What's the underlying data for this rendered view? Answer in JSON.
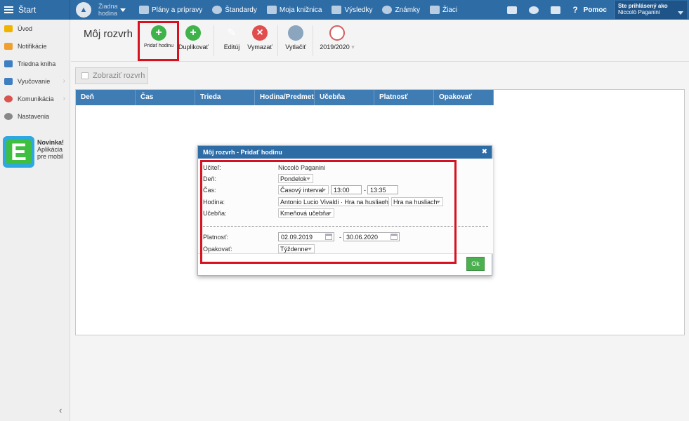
{
  "topbar": {
    "start_label": "Štart",
    "hodina_label": "Žiadna hodina",
    "nav": [
      {
        "label": "Plány a prípravy",
        "icon": "folder-icon"
      },
      {
        "label": "Štandardy",
        "icon": "shield-icon"
      },
      {
        "label": "Moja knižnica",
        "icon": "book-icon"
      },
      {
        "label": "Výsledky",
        "icon": "chart-icon"
      },
      {
        "label": "Známky",
        "icon": "grade-icon"
      },
      {
        "label": "Žiaci",
        "icon": "students-icon"
      }
    ],
    "help_label": "Pomoc",
    "user_caption": "Ste prihlásený ako",
    "user_name": "Niccolò Paganini"
  },
  "sidebar": {
    "items": [
      {
        "label": "Úvod",
        "icon": "star-icon",
        "color": "#f0b400"
      },
      {
        "label": "Notifikácie",
        "icon": "envelope-icon",
        "color": "#f0a030"
      },
      {
        "label": "Triedna kniha",
        "icon": "class-book-icon",
        "color": "#3d7fc1"
      },
      {
        "label": "Vyučovanie",
        "icon": "briefcase-icon",
        "color": "#3d7fc1"
      },
      {
        "label": "Komunikácia",
        "icon": "chat-icon",
        "color": "#d9534f"
      },
      {
        "label": "Nastavenia",
        "icon": "gear-icon",
        "color": "#888888"
      }
    ],
    "novinka_title": "Novinka!",
    "novinka_line1": "Aplikácia",
    "novinka_line2": "pre mobil",
    "logo_letter": "E"
  },
  "toolbar": {
    "title": "Môj rozvrh",
    "pridat": "Pridať hodinu",
    "duplikovat": "Duplikovať",
    "editovat": "Editúj",
    "vymazat": "Vymazať",
    "vytlacit": "Vytlačiť",
    "year": "2019/2020"
  },
  "content": {
    "zobrazit": "Zobraziť rozvrh",
    "columns": [
      "Deň",
      "Čas",
      "Trieda",
      "Hodina/Predmet",
      "Učebňa",
      "Platnosť",
      "Opakovať"
    ]
  },
  "dialog": {
    "title": "Môj rozvrh - Pridať hodinu",
    "ucitel_label": "Učiteľ:",
    "ucitel_value": "Niccolò Paganini",
    "den_label": "Deň:",
    "den_value": "Pondelok",
    "cas_label": "Čas:",
    "cas_type": "Časový interval",
    "cas_from": "13:00",
    "cas_to": "13:35",
    "separator": "-",
    "hodina_label": "Hodina:",
    "hodina_value": "Antonio Lucio Vivaldi · Hra na husliach",
    "predmet_value": "Hra na husliach",
    "ucebna_label": "Učebňa:",
    "ucebna_value": "Kmeňová učebňa",
    "platnost_label": "Platnosť:",
    "platnost_from": "02.09.2019",
    "platnost_to": "30.06.2020",
    "opakovat_label": "Opakovať:",
    "opakovat_value": "Týždenne",
    "ok_label": "Ok"
  }
}
